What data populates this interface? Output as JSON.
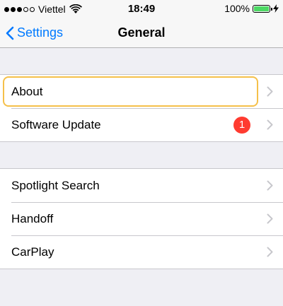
{
  "status_bar": {
    "carrier": "Viettel",
    "time": "18:49",
    "battery_percent": "100%",
    "battery_color": "#4cd964",
    "signal_bars_filled": 3,
    "signal_bars_total": 5
  },
  "nav": {
    "back_label": "Settings",
    "title": "General",
    "accent_color": "#007aff"
  },
  "group1": {
    "items": [
      {
        "label": "About",
        "highlighted": true
      },
      {
        "label": "Software Update",
        "badge": "1"
      }
    ]
  },
  "group2": {
    "items": [
      {
        "label": "Spotlight Search"
      },
      {
        "label": "Handoff"
      },
      {
        "label": "CarPlay"
      }
    ]
  }
}
